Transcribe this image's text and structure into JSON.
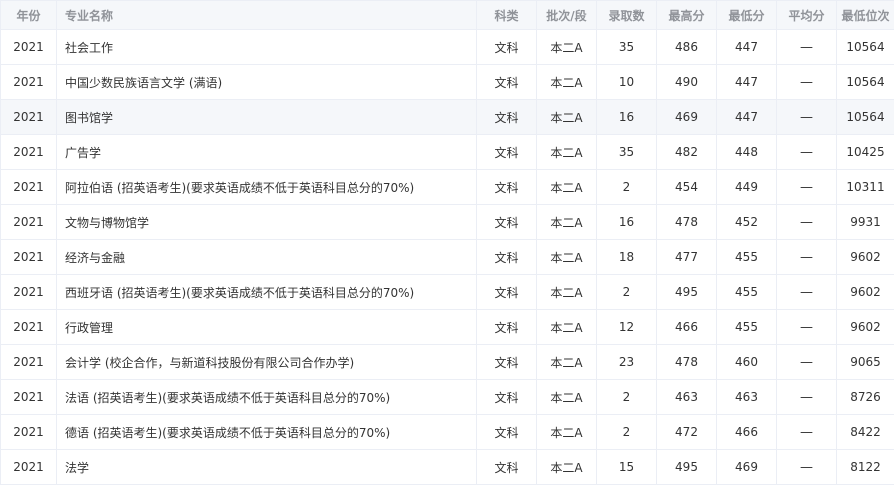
{
  "table": {
    "headers": {
      "year": "年份",
      "major": "专业名称",
      "subject": "科类",
      "batch": "批次/段",
      "admitted": "录取数",
      "max": "最高分",
      "min": "最低分",
      "avg": "平均分",
      "min_rank": "最低位次"
    },
    "rows": [
      {
        "year": "2021",
        "major": "社会工作",
        "subject": "文科",
        "batch": "本二A",
        "admitted": "35",
        "max": "486",
        "min": "447",
        "avg": "—",
        "min_rank": "10564"
      },
      {
        "year": "2021",
        "major": "中国少数民族语言文学 (满语)",
        "subject": "文科",
        "batch": "本二A",
        "admitted": "10",
        "max": "490",
        "min": "447",
        "avg": "—",
        "min_rank": "10564"
      },
      {
        "year": "2021",
        "major": "图书馆学",
        "subject": "文科",
        "batch": "本二A",
        "admitted": "16",
        "max": "469",
        "min": "447",
        "avg": "—",
        "min_rank": "10564"
      },
      {
        "year": "2021",
        "major": "广告学",
        "subject": "文科",
        "batch": "本二A",
        "admitted": "35",
        "max": "482",
        "min": "448",
        "avg": "—",
        "min_rank": "10425"
      },
      {
        "year": "2021",
        "major": "阿拉伯语 (招英语考生)(要求英语成绩不低于英语科目总分的70%)",
        "subject": "文科",
        "batch": "本二A",
        "admitted": "2",
        "max": "454",
        "min": "449",
        "avg": "—",
        "min_rank": "10311"
      },
      {
        "year": "2021",
        "major": "文物与博物馆学",
        "subject": "文科",
        "batch": "本二A",
        "admitted": "16",
        "max": "478",
        "min": "452",
        "avg": "—",
        "min_rank": "9931"
      },
      {
        "year": "2021",
        "major": "经济与金融",
        "subject": "文科",
        "batch": "本二A",
        "admitted": "18",
        "max": "477",
        "min": "455",
        "avg": "—",
        "min_rank": "9602"
      },
      {
        "year": "2021",
        "major": "西班牙语 (招英语考生)(要求英语成绩不低于英语科目总分的70%)",
        "subject": "文科",
        "batch": "本二A",
        "admitted": "2",
        "max": "495",
        "min": "455",
        "avg": "—",
        "min_rank": "9602"
      },
      {
        "year": "2021",
        "major": "行政管理",
        "subject": "文科",
        "batch": "本二A",
        "admitted": "12",
        "max": "466",
        "min": "455",
        "avg": "—",
        "min_rank": "9602"
      },
      {
        "year": "2021",
        "major": "会计学 (校企合作，与新道科技股份有限公司合作办学)",
        "subject": "文科",
        "batch": "本二A",
        "admitted": "23",
        "max": "478",
        "min": "460",
        "avg": "—",
        "min_rank": "9065"
      },
      {
        "year": "2021",
        "major": "法语 (招英语考生)(要求英语成绩不低于英语科目总分的70%)",
        "subject": "文科",
        "batch": "本二A",
        "admitted": "2",
        "max": "463",
        "min": "463",
        "avg": "—",
        "min_rank": "8726"
      },
      {
        "year": "2021",
        "major": "德语 (招英语考生)(要求英语成绩不低于英语科目总分的70%)",
        "subject": "文科",
        "batch": "本二A",
        "admitted": "2",
        "max": "472",
        "min": "466",
        "avg": "—",
        "min_rank": "8422"
      },
      {
        "year": "2021",
        "major": "法学",
        "subject": "文科",
        "batch": "本二A",
        "admitted": "15",
        "max": "495",
        "min": "469",
        "avg": "—",
        "min_rank": "8122"
      }
    ]
  }
}
